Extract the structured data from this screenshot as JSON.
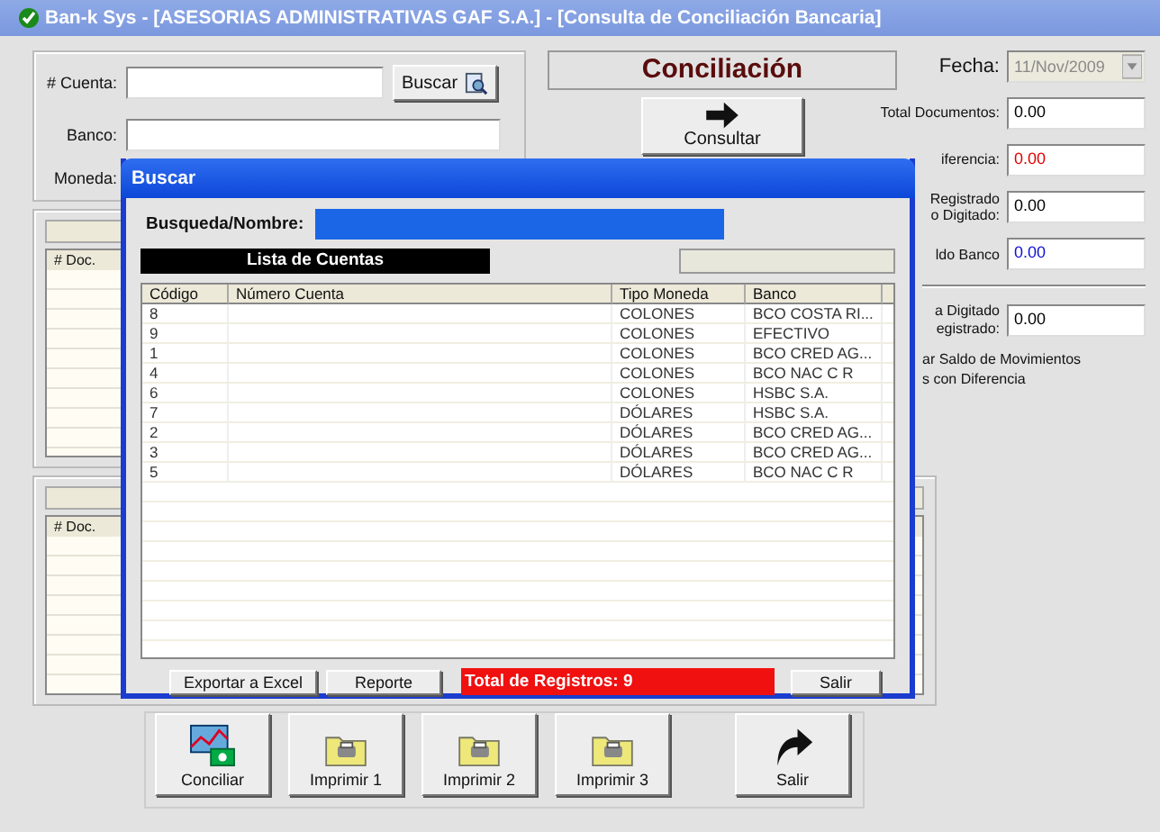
{
  "window": {
    "title": "Ban-k Sys - [ASESORIAS ADMINISTRATIVAS GAF S.A.] - [Consulta de Conciliación Bancaria]"
  },
  "account_form": {
    "account_label": "# Cuenta:",
    "search_button": "Buscar",
    "bank_label": "Banco:",
    "currency_label": "Moneda:"
  },
  "header": {
    "title": "Conciliación",
    "consult_button": "Consultar"
  },
  "date": {
    "label": "Fecha:",
    "value": "11/Nov/2009",
    "disabled": true
  },
  "totals": [
    {
      "label": [
        "Total Documentos:"
      ],
      "value": "0.00",
      "color": "#000000"
    },
    {
      "label": [
        "iferencia:"
      ],
      "value": "0.00",
      "color": "#e00000"
    },
    {
      "label": [
        "Registrado",
        "o Digitado:"
      ],
      "value": "0.00",
      "color": "#000000"
    },
    {
      "label": [
        "ldo Banco"
      ],
      "value": "0.00",
      "color": "#1010d0"
    },
    {
      "label": [
        "a Digitado",
        "egistrado:"
      ],
      "value": "0.00",
      "color": "#000000"
    }
  ],
  "note_lines": [
    "ar Saldo de Movimientos",
    "s con Diferencia"
  ],
  "grids": [
    {
      "columns": [
        "# Doc."
      ]
    },
    {
      "columns": [
        "# Doc."
      ]
    }
  ],
  "actions": [
    {
      "label": "Conciliar",
      "kind": "chart"
    },
    {
      "label": "Imprimir 1",
      "kind": "print"
    },
    {
      "label": "Imprimir 2",
      "kind": "print"
    },
    {
      "label": "Imprimir 3",
      "kind": "print"
    },
    {
      "label": "Salir",
      "kind": "exit"
    }
  ],
  "dialog": {
    "title": "Buscar",
    "search_label": "Busqueda/Nombre:",
    "list_title": "Lista de Cuentas",
    "columns": [
      "Código",
      "Número Cuenta",
      "Tipo Moneda",
      "Banco"
    ],
    "rows": [
      [
        "8",
        "",
        "COLONES",
        "BCO COSTA RI..."
      ],
      [
        "9",
        "",
        "COLONES",
        "EFECTIVO"
      ],
      [
        "1",
        "",
        "COLONES",
        "BCO CRED AG..."
      ],
      [
        "4",
        "",
        "COLONES",
        "BCO NAC C R"
      ],
      [
        "6",
        "",
        "COLONES",
        "HSBC S.A."
      ],
      [
        "7",
        "",
        "DÓLARES",
        "HSBC S.A."
      ],
      [
        "2",
        "",
        "DÓLARES",
        "BCO CRED AG..."
      ],
      [
        "3",
        "",
        "DÓLARES",
        "BCO CRED AG..."
      ],
      [
        "5",
        "",
        "DÓLARES",
        "BCO NAC C R"
      ]
    ],
    "buttons": [
      "Exportar a Excel",
      "Reporte"
    ],
    "total": "Total de Registros: 9",
    "close_button": "Salir"
  }
}
